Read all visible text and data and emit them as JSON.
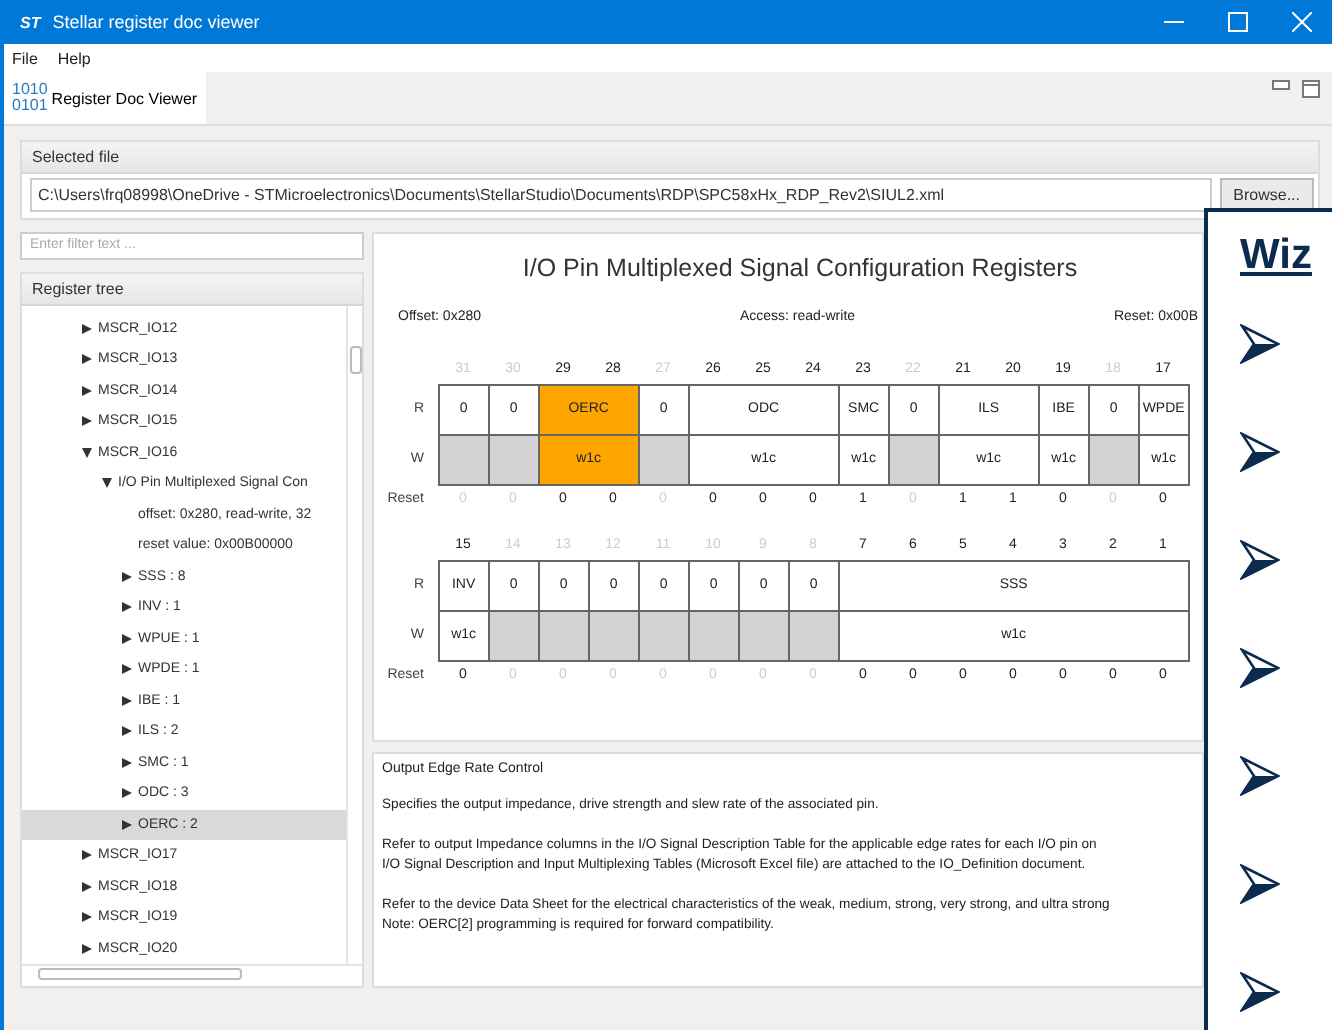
{
  "window": {
    "logo": "ST",
    "title": "Stellar register doc viewer"
  },
  "menu": [
    {
      "label": "File"
    },
    {
      "label": "Help"
    }
  ],
  "tabs": [
    {
      "icon_lines": [
        "1010",
        "0101"
      ],
      "label": "Register Doc Viewer",
      "selected": true
    }
  ],
  "file_panel": {
    "header": "Selected file",
    "path": "C:\\Users\\frq08998\\OneDrive - STMicroelectronics\\Documents\\StellarStudio\\Documents\\RDP\\SPC58xHx_RDP_Rev2\\SIUL2.xml",
    "browse": "Browse..."
  },
  "filter": {
    "placeholder": "Enter filter text ..."
  },
  "tree": {
    "header": "Register tree",
    "items": [
      {
        "label": "MSCR_IO12",
        "kind": "node",
        "expanded": false,
        "selected": false
      },
      {
        "label": "MSCR_IO13",
        "kind": "node",
        "expanded": false,
        "selected": false
      },
      {
        "label": "MSCR_IO14",
        "kind": "node",
        "expanded": false,
        "selected": false
      },
      {
        "label": "MSCR_IO15",
        "kind": "node",
        "expanded": false,
        "selected": false
      },
      {
        "label": "MSCR_IO16",
        "kind": "node",
        "expanded": true,
        "selected": false,
        "children": [
          {
            "label": "I/O Pin Multiplexed Signal Con",
            "kind": "node",
            "expanded": true,
            "selected": false,
            "children": [
              {
                "label": "offset: 0x280, read-write, 32",
                "kind": "info"
              },
              {
                "label": "reset value: 0x00B00000",
                "kind": "info"
              },
              {
                "label": "SSS : 8",
                "kind": "node",
                "expanded": false,
                "selected": false
              },
              {
                "label": "INV : 1",
                "kind": "node",
                "expanded": false,
                "selected": false
              },
              {
                "label": "WPUE : 1",
                "kind": "node",
                "expanded": false,
                "selected": false
              },
              {
                "label": "WPDE : 1",
                "kind": "node",
                "expanded": false,
                "selected": false
              },
              {
                "label": "IBE : 1",
                "kind": "node",
                "expanded": false,
                "selected": false
              },
              {
                "label": "ILS : 2",
                "kind": "node",
                "expanded": false,
                "selected": false
              },
              {
                "label": "SMC : 1",
                "kind": "node",
                "expanded": false,
                "selected": false
              },
              {
                "label": "ODC : 3",
                "kind": "node",
                "expanded": false,
                "selected": false
              },
              {
                "label": "OERC : 2",
                "kind": "node",
                "expanded": false,
                "selected": true
              }
            ]
          }
        ]
      },
      {
        "label": "MSCR_IO17",
        "kind": "node",
        "expanded": false,
        "selected": false
      },
      {
        "label": "MSCR_IO18",
        "kind": "node",
        "expanded": false,
        "selected": false
      },
      {
        "label": "MSCR_IO19",
        "kind": "node",
        "expanded": false,
        "selected": false
      },
      {
        "label": "MSCR_IO20",
        "kind": "node",
        "expanded": false,
        "selected": false
      }
    ]
  },
  "register": {
    "title": "I/O Pin Multiplexed Signal Configuration Registers",
    "offset": "Offset: 0x280",
    "access": "Access: read-write",
    "reset": "Reset: 0x00B",
    "blocks": [
      {
        "read_label": "R",
        "write_label": "W",
        "reset_label": "Reset",
        "fields": [
          {
            "read": "0",
            "reserved": true,
            "selected": false,
            "bits": [
              {
                "label": "31",
                "reset": "0"
              }
            ]
          },
          {
            "read": "0",
            "reserved": true,
            "selected": false,
            "bits": [
              {
                "label": "30",
                "reset": "0"
              }
            ]
          },
          {
            "read": "OERC",
            "write": "w1c",
            "reserved": false,
            "selected": true,
            "bits": [
              {
                "label": "29",
                "reset": "0"
              },
              {
                "label": "28",
                "reset": "0"
              }
            ]
          },
          {
            "read": "0",
            "reserved": true,
            "selected": false,
            "bits": [
              {
                "label": "27",
                "reset": "0"
              }
            ]
          },
          {
            "read": "ODC",
            "write": "w1c",
            "reserved": false,
            "selected": false,
            "bits": [
              {
                "label": "26",
                "reset": "0"
              },
              {
                "label": "25",
                "reset": "0"
              },
              {
                "label": "24",
                "reset": "0"
              }
            ]
          },
          {
            "read": "SMC",
            "write": "w1c",
            "reserved": false,
            "selected": false,
            "bits": [
              {
                "label": "23",
                "reset": "1"
              }
            ]
          },
          {
            "read": "0",
            "reserved": true,
            "selected": false,
            "bits": [
              {
                "label": "22",
                "reset": "0"
              }
            ]
          },
          {
            "read": "ILS",
            "write": "w1c",
            "reserved": false,
            "selected": false,
            "bits": [
              {
                "label": "21",
                "reset": "1"
              },
              {
                "label": "20",
                "reset": "1"
              }
            ]
          },
          {
            "read": "IBE",
            "write": "w1c",
            "reserved": false,
            "selected": false,
            "bits": [
              {
                "label": "19",
                "reset": "0"
              }
            ]
          },
          {
            "read": "0",
            "reserved": true,
            "selected": false,
            "bits": [
              {
                "label": "18",
                "reset": "0"
              }
            ]
          },
          {
            "read": "WPDE",
            "write": "w1c",
            "reserved": false,
            "selected": false,
            "bits": [
              {
                "label": "17",
                "reset": "0"
              }
            ]
          }
        ]
      },
      {
        "read_label": "R",
        "write_label": "W",
        "reset_label": "Reset",
        "fields": [
          {
            "read": "INV",
            "write": "w1c",
            "reserved": false,
            "selected": false,
            "bits": [
              {
                "label": "15",
                "reset": "0"
              }
            ]
          },
          {
            "read": "0",
            "reserved": true,
            "selected": false,
            "bits": [
              {
                "label": "14",
                "reset": "0"
              }
            ]
          },
          {
            "read": "0",
            "reserved": true,
            "selected": false,
            "bits": [
              {
                "label": "13",
                "reset": "0"
              }
            ]
          },
          {
            "read": "0",
            "reserved": true,
            "selected": false,
            "bits": [
              {
                "label": "12",
                "reset": "0"
              }
            ]
          },
          {
            "read": "0",
            "reserved": true,
            "selected": false,
            "bits": [
              {
                "label": "11",
                "reset": "0"
              }
            ]
          },
          {
            "read": "0",
            "reserved": true,
            "selected": false,
            "bits": [
              {
                "label": "10",
                "reset": "0"
              }
            ]
          },
          {
            "read": "0",
            "reserved": true,
            "selected": false,
            "bits": [
              {
                "label": "9",
                "reset": "0"
              }
            ]
          },
          {
            "read": "0",
            "reserved": true,
            "selected": false,
            "bits": [
              {
                "label": "8",
                "reset": "0"
              }
            ]
          },
          {
            "read": "SSS",
            "write": "w1c",
            "reserved": false,
            "selected": false,
            "bits": [
              {
                "label": "7",
                "reset": "0"
              },
              {
                "label": "6",
                "reset": "0"
              },
              {
                "label": "5",
                "reset": "0"
              },
              {
                "label": "4",
                "reset": "0"
              },
              {
                "label": "3",
                "reset": "0"
              },
              {
                "label": "2",
                "reset": "0"
              },
              {
                "label": "1",
                "reset": "0"
              }
            ]
          }
        ]
      }
    ]
  },
  "description": {
    "title": "Output Edge Rate Control",
    "paragraphs": [
      [
        "Specifies the output impedance, drive strength and slew rate of the associated pin."
      ],
      [
        "Refer to output Impedance columns in the I/O Signal Description Table for the applicable edge rates for each I/O pin on",
        "I/O Signal Description and Input Multiplexing Tables (Microsoft Excel file) are attached to the IO_Definition document."
      ],
      [
        "Refer to the device Data Sheet for the electrical characteristics of the weak, medium, strong, very strong, and ultra strong",
        "Note: OERC[2] programming is required for forward compatibility."
      ]
    ]
  },
  "overlay": {
    "title": "Wiz"
  }
}
